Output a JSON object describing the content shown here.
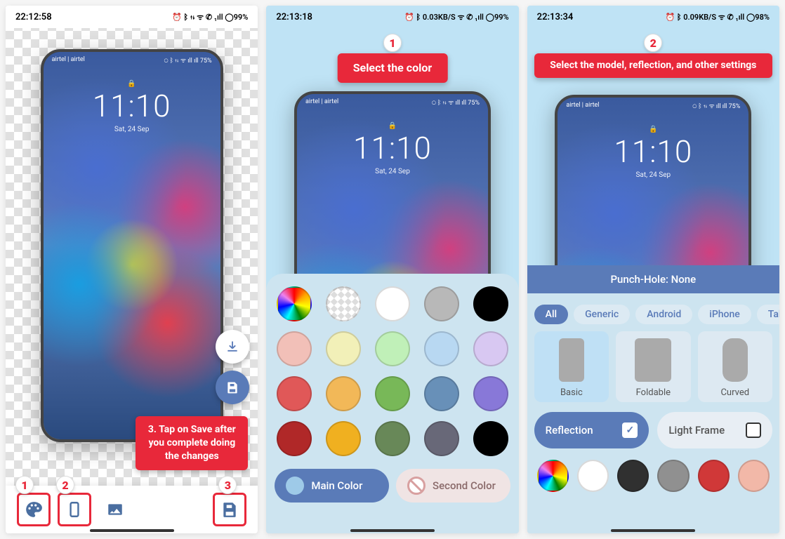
{
  "screen1": {
    "status": {
      "time": "22:12:58",
      "right": "⏰ ᛒ ⇅ ᯤ ✆ ₁ıll ◯99%"
    },
    "mockup": {
      "carrier": "airtel | airtel",
      "right": "◯ ᛒ ⇅ ᯤ ıll ıll 75%",
      "time": "11:10",
      "date": "Sat, 24 Sep"
    },
    "callout": "3. Tap on Save after you complete doing the changes",
    "badges": {
      "b1": "1",
      "b2": "2",
      "b3": "3"
    }
  },
  "screen2": {
    "status": {
      "time": "22:13:18",
      "right": "⏰ ᛒ 0.03KB/S ᯤ ✆ ₁ıll ◯99%"
    },
    "callout": "Select the color",
    "badge": "1",
    "mockup": {
      "carrier": "airtel | airtel",
      "right": "◯ ᛒ ⇅ ᯤ ıll ıll 75%",
      "time": "11:10",
      "date": "Sat, 24 Sep"
    },
    "colors": [
      "rainbow",
      "transparent",
      "#ffffff",
      "#b8b8b8",
      "#000000",
      "#f2c0b8",
      "#f2f0b8",
      "#c0f0b8",
      "#b8d8f2",
      "#d8c8f2",
      "#e05858",
      "#f2b858",
      "#78b858",
      "#6890b8",
      "#8878d8",
      "#b02828",
      "#f0b020",
      "#688858",
      "#686878",
      "#000000"
    ],
    "mainColor": "Main Color",
    "secondColor": "Second Color"
  },
  "screen3": {
    "status": {
      "time": "22:13:34",
      "right": "⏰ ᛒ 0.09KB/S ᯤ ✆ ₁ıll ◯98%"
    },
    "callout": "Select the model, reflection, and other settings",
    "badge": "2",
    "mockup": {
      "carrier": "airtel | airtel",
      "right": "◯ ᛒ ⇅ ᯤ ıll ıll 75%",
      "time": "11:10",
      "date": "Sat, 24 Sep"
    },
    "punchHole": "Punch-Hole: None",
    "chips": [
      "All",
      "Generic",
      "Android",
      "iPhone",
      "Tablet"
    ],
    "models": [
      "Basic",
      "Foldable",
      "Curved"
    ],
    "reflection": "Reflection",
    "lightFrame": "Light Frame",
    "frameColors": [
      "rainbow",
      "#ffffff",
      "#303030",
      "#909090",
      "#d03838",
      "#f2b8a8"
    ]
  }
}
